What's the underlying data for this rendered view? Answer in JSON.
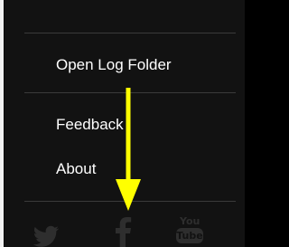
{
  "menu": {
    "items": [
      {
        "label": "Open Log Folder"
      },
      {
        "label": "Feedback"
      },
      {
        "label": "About"
      }
    ]
  },
  "social": {
    "icons": [
      "twitter-icon",
      "facebook-icon",
      "youtube-icon"
    ],
    "youtube_top": "You",
    "youtube_bottom": "Tube"
  },
  "colors": {
    "panel_background": "#121212",
    "menu_text": "#ffffff",
    "separator": "#3a3a3a",
    "social_icon": "#2e2e2e",
    "annotation_arrow": "#ffff00"
  }
}
